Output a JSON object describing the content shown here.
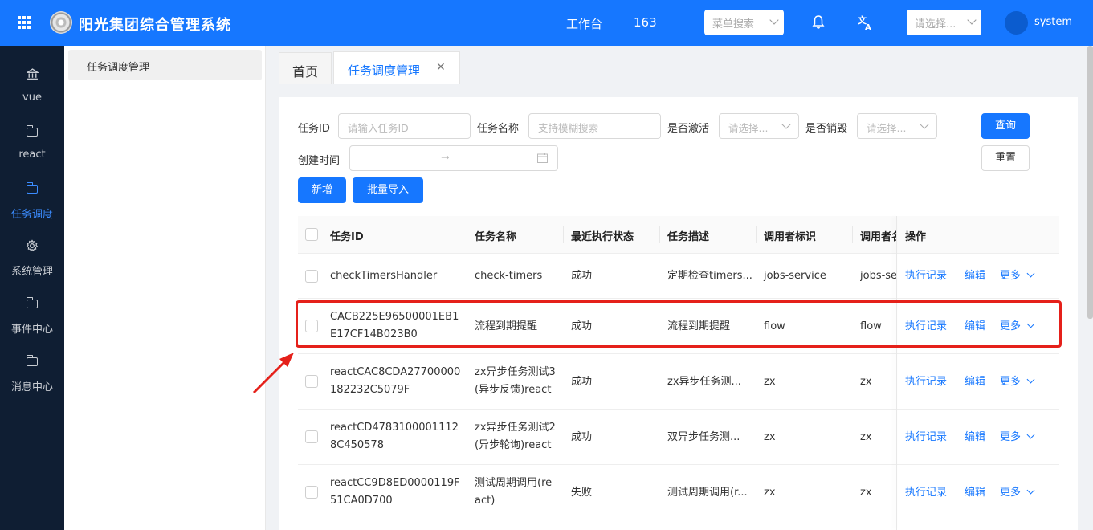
{
  "header": {
    "title": "阳光集团综合管理系统",
    "workbench": "工作台",
    "count": "163",
    "menu_search_placeholder": "菜单搜索",
    "lang_placeholder": "请选择...",
    "username": "system"
  },
  "leftnav": {
    "items": [
      {
        "label": "vue",
        "icon": "bank-icon"
      },
      {
        "label": "react",
        "icon": "folder-icon"
      },
      {
        "label": "任务调度",
        "icon": "folder-icon",
        "active": true
      },
      {
        "label": "系统管理",
        "icon": "gear-icon"
      },
      {
        "label": "事件中心",
        "icon": "folder-icon"
      },
      {
        "label": "消息中心",
        "icon": "folder-icon"
      }
    ]
  },
  "submenu": {
    "item": "任务调度管理"
  },
  "tabs": {
    "home": "首页",
    "active": "任务调度管理",
    "close": "✕"
  },
  "filters": {
    "task_id_label": "任务ID",
    "task_id_placeholder": "请输入任务ID",
    "task_name_label": "任务名称",
    "task_name_placeholder": "支持模糊搜索",
    "active_label": "是否激活",
    "active_placeholder": "请选择...",
    "destroyed_label": "是否销毁",
    "destroyed_placeholder": "请选择...",
    "created_label": "创建时间",
    "range_arrow": "→",
    "query": "查询",
    "reset": "重置",
    "add": "新增",
    "batch_import": "批量导入"
  },
  "table": {
    "headers": [
      "任务ID",
      "任务名称",
      "最近执行状态",
      "任务描述",
      "调用者标识",
      "调用者名",
      "操作"
    ],
    "actions": {
      "records": "执行记录",
      "edit": "编辑",
      "more": "更多"
    },
    "rows": [
      {
        "id": "checkTimersHandler",
        "name": "check-timers",
        "status": "成功",
        "desc": "定期检查timers...",
        "caller": "jobs-service",
        "caller_name": "jobs-ser"
      },
      {
        "id": "CACB225E96500001EB1E17CF14B023B0",
        "name": "流程到期提醒",
        "status": "成功",
        "desc": "流程到期提醒",
        "caller": "flow",
        "caller_name": "flow"
      },
      {
        "id": "reactCAC8CDA27700000182232C5079F",
        "name": "zx异步任务测试3(异步反馈)react",
        "status": "成功",
        "desc": "zx异步任务测...",
        "caller": "zx",
        "caller_name": "zx"
      },
      {
        "id": "reactCD47831000011128C450578",
        "name": "zx异步任务测试2(异步轮询)react",
        "status": "成功",
        "desc": "双异步任务测...",
        "caller": "zx",
        "caller_name": "zx"
      },
      {
        "id": "reactCC9D8ED0000119F51CA0D700",
        "name": "测试周期调用(react)",
        "status": "失败",
        "desc": "测试周期调用(r...",
        "caller": "zx",
        "caller_name": "zx"
      }
    ]
  },
  "colors": {
    "primary": "#1677ff",
    "nav_bg": "#0f1e33",
    "highlight": "#e5201a"
  }
}
